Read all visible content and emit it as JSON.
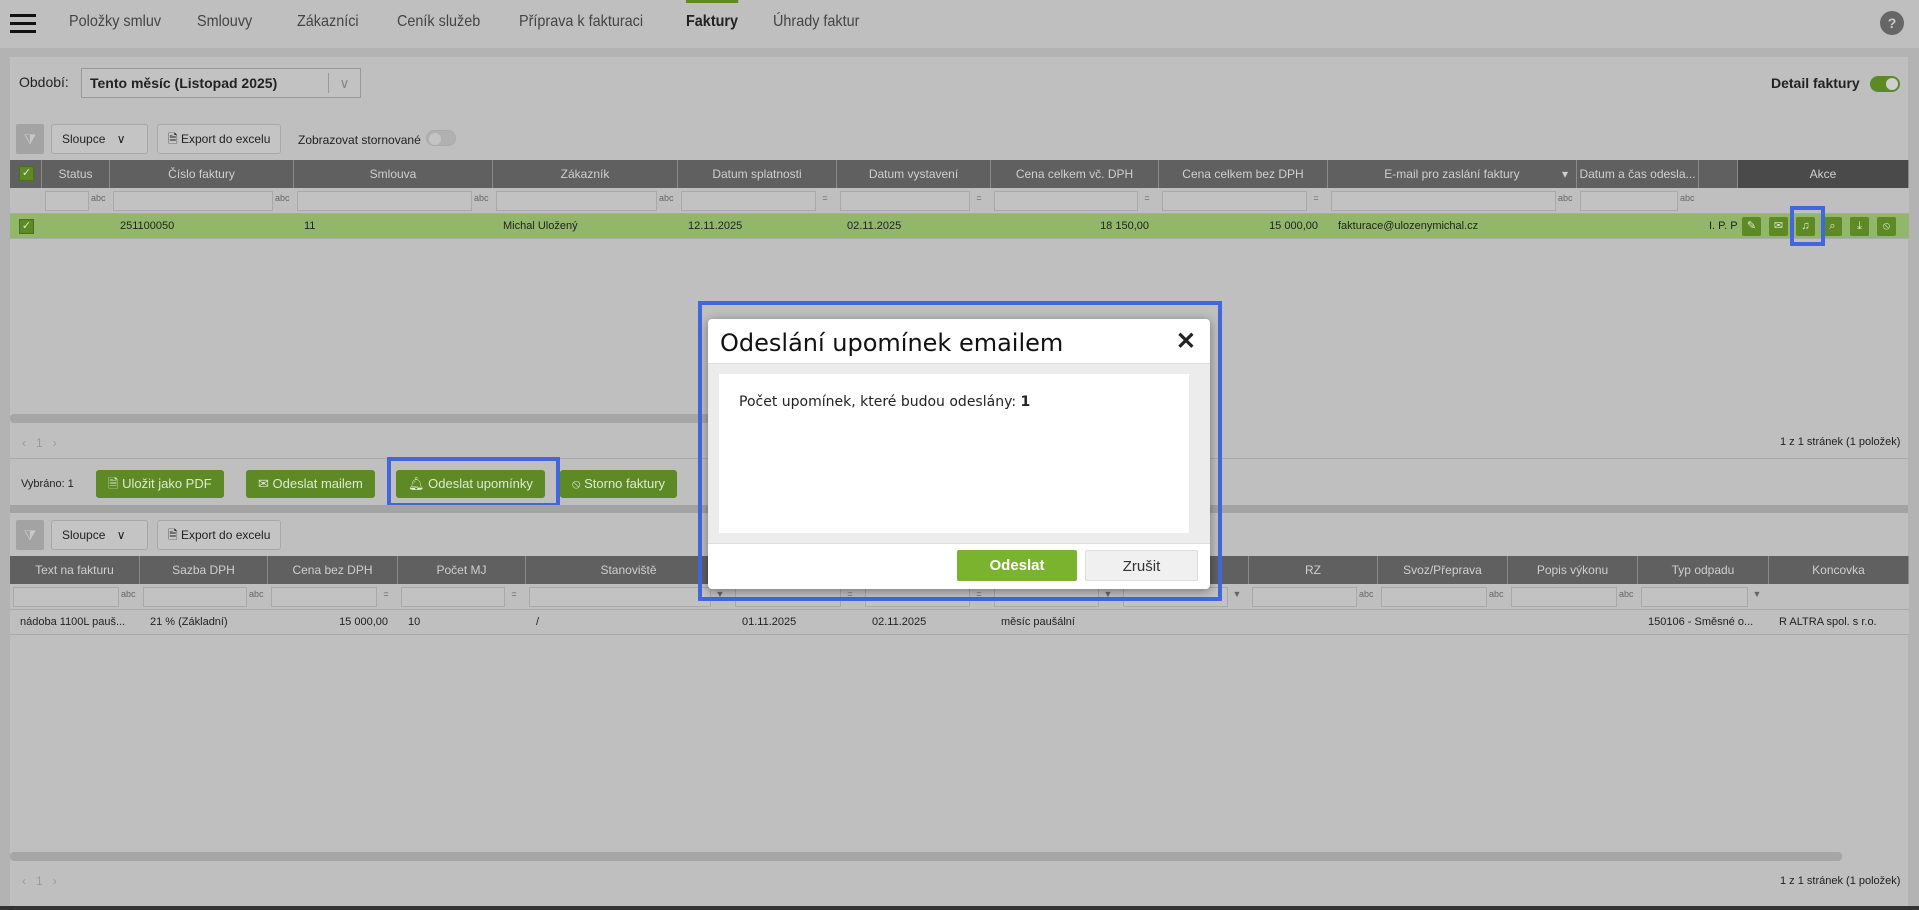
{
  "nav": {
    "items": [
      "Položky smluv",
      "Smlouvy",
      "Zákazníci",
      "Ceník služeb",
      "Příprava k fakturaci",
      "Faktury",
      "Úhrady faktur"
    ],
    "active": "Faktury",
    "help": "?"
  },
  "period": {
    "label": "Období:",
    "value": "Tento měsíc (Listopad 2025)"
  },
  "detail": {
    "label": "Detail faktury",
    "on": true
  },
  "toolbar": {
    "columns": "Sloupce",
    "export": "Export do excelu",
    "show_cancelled": "Zobrazovat stornované"
  },
  "invoices": {
    "columns": [
      "",
      "Status",
      "Číslo faktury",
      "Smlouva",
      "Zákazník",
      "Datum splatnosti",
      "Datum vystavení",
      "Cena celkem vč. DPH",
      "Cena celkem bez DPH",
      "E-mail pro zaslání faktury",
      "Datum a čas odesla...",
      "",
      "Akce"
    ],
    "rows": [
      {
        "cells": [
          "",
          "",
          "251100050",
          "11",
          "Michal Uložený",
          "12.11.2025",
          "02.11.2025",
          "18 150,00",
          "15 000,00",
          "fakturace@ulozenymichal.cz",
          "",
          "I. P. P",
          ""
        ],
        "selected": true
      }
    ],
    "pager": {
      "page": "1",
      "summary": "1 z 1 stránek (1 položek)"
    }
  },
  "selection": {
    "label": "Vybráno: 1",
    "buttons": [
      "Uložit jako PDF",
      "Odeslat mailem",
      "Odeslat upomínky",
      "Storno faktury"
    ]
  },
  "items": {
    "columns": [
      "Text na fakturu",
      "Sazba DPH",
      "Cena bez DPH",
      "Počet MJ",
      "Stanoviště",
      "",
      "",
      "",
      "",
      "RZ",
      "Svoz/Přeprava",
      "Popis výkonu",
      "Typ odpadu",
      "Koncovka"
    ],
    "rows": [
      {
        "cells": [
          "nádoba 1100L pauš...",
          "21 % (Základní)",
          "15 000,00",
          "10",
          "/",
          "01.11.2025",
          "02.11.2025",
          "měsíc paušální",
          "",
          "",
          "",
          "",
          "150106 - Směsné o...",
          "R ALTRA spol. s r.o."
        ]
      }
    ],
    "pager": {
      "page": "1",
      "summary": "1 z 1 stránek (1 položek)"
    }
  },
  "modal": {
    "title": "Odeslání upomínek emailem",
    "message": "Počet upomínek, které budou odeslány:",
    "count": "1",
    "confirm": "Odeslat",
    "cancel": "Zrušit"
  },
  "colors": {
    "accent": "#5e8a26",
    "highlight": "#4466dd",
    "confirm": "#7ab32e"
  }
}
